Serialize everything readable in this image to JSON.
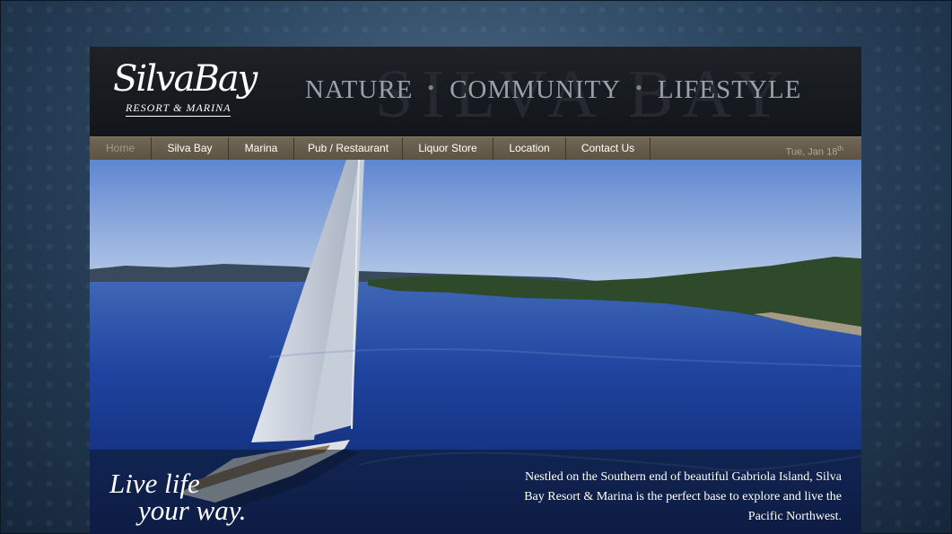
{
  "header": {
    "logo": {
      "script": "SilvaBay",
      "subtitle": "RESORT & MARINA"
    },
    "watermark": "SILVA BAY",
    "tagline": {
      "words": [
        "NATURE",
        "COMMUNITY",
        "LIFESTYLE"
      ],
      "separator": "•"
    }
  },
  "nav": {
    "items": [
      {
        "label": "Home",
        "active": true
      },
      {
        "label": "Silva Bay"
      },
      {
        "label": "Marina"
      },
      {
        "label": "Pub / Restaurant"
      },
      {
        "label": "Liquor Store"
      },
      {
        "label": "Location"
      },
      {
        "label": "Contact Us"
      }
    ],
    "date": {
      "text": "Tue, Jan 18",
      "suffix": "th"
    }
  },
  "hero": {
    "slogan": {
      "line1": "Live life",
      "line2": "your way."
    },
    "intro": "Nestled on the Southern end of beautiful Gabriola Island, Silva Bay Resort & Marina is the perfect base to explore and live the Pacific Northwest."
  },
  "colors": {
    "header_bg": "#16191d",
    "nav_bg": "#685d4c",
    "page_bg": "#2c4660",
    "sea": "#1c3d8f",
    "sky": "#7da0db"
  }
}
